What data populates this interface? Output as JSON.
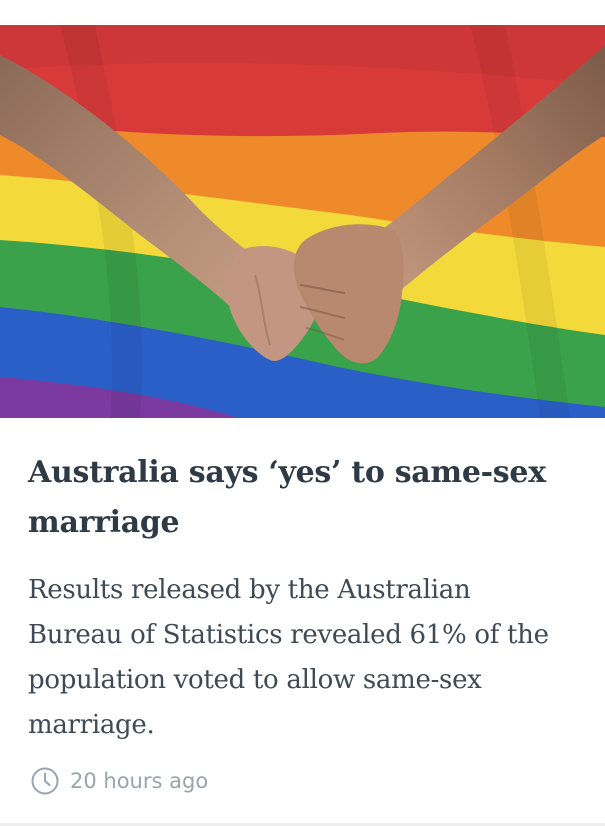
{
  "article": {
    "image_icon": "hands-holding-over-rainbow-flag-image",
    "headline": "Australia says ‘yes’ to same-sex marriage",
    "summary": "Results released by the Australian Bureau of Statistics revealed 61% of the population voted to allow same-sex marriage.",
    "timestamp": "20 hours ago",
    "timestamp_icon": "clock-icon"
  },
  "colors": {
    "headline": "#2e3a46",
    "body": "#3f4a55",
    "meta": "#9aa4ad",
    "flag_red": "#d83a3a",
    "flag_orange": "#ef8a2a",
    "flag_yellow": "#f3d93a",
    "flag_green": "#3aa24a",
    "flag_blue": "#2b5fc8",
    "flag_purple": "#7a3aa0"
  }
}
